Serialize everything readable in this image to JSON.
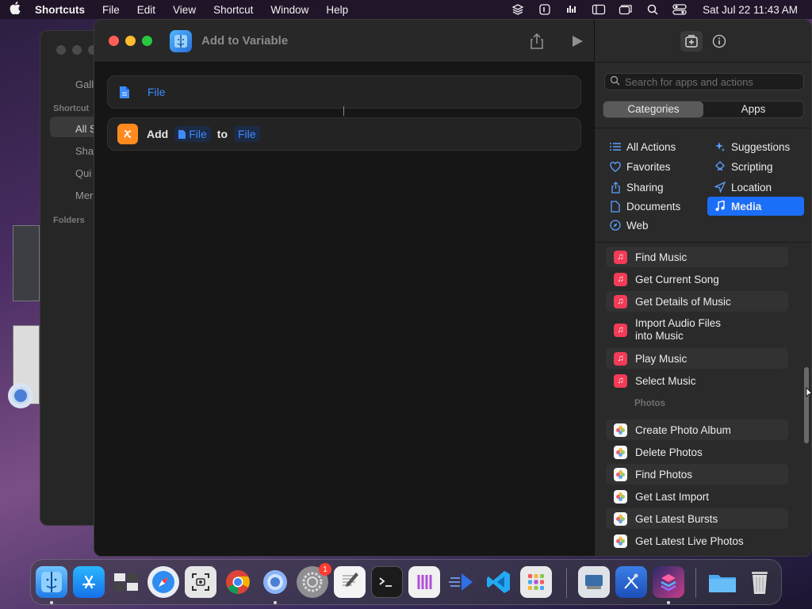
{
  "menubar": {
    "app_name": "Shortcuts",
    "items": [
      "File",
      "Edit",
      "View",
      "Shortcut",
      "Window",
      "Help"
    ],
    "clock": "Sat Jul 22  11:43 AM"
  },
  "background_window": {
    "items": [
      "Gall",
      "Shortcut",
      "All S",
      "Sha",
      "Qui",
      "Mer",
      "Folders"
    ]
  },
  "window": {
    "title": "Add to Variable"
  },
  "editor": {
    "action1": {
      "label": "File"
    },
    "action2": {
      "verb": "Add",
      "token1": "File",
      "connector": "to",
      "token2": "File"
    }
  },
  "panel": {
    "search_placeholder": "Search for apps and actions",
    "segments": [
      "Categories",
      "Apps"
    ],
    "categories_left": [
      {
        "label": "All Actions",
        "icon": "list-icon"
      },
      {
        "label": "Favorites",
        "icon": "heart-icon"
      },
      {
        "label": "Sharing",
        "icon": "share-icon"
      },
      {
        "label": "Documents",
        "icon": "document-icon"
      },
      {
        "label": "Web",
        "icon": "compass-icon"
      }
    ],
    "categories_right": [
      {
        "label": "Suggestions",
        "icon": "sparkle-icon"
      },
      {
        "label": "Scripting",
        "icon": "scripting-icon"
      },
      {
        "label": "Location",
        "icon": "location-icon"
      },
      {
        "label": "Media",
        "icon": "music-note-icon",
        "active": true
      }
    ],
    "music_actions": [
      "Find Music",
      "Get Current Song",
      "Get Details of Music",
      "Import Audio Files into Music",
      "Play Music",
      "Select Music"
    ],
    "photos_header": "Photos",
    "photo_actions": [
      "Create Photo Album",
      "Delete Photos",
      "Find Photos",
      "Get Last Import",
      "Get Latest Bursts",
      "Get Latest Live Photos"
    ]
  },
  "dock": {
    "apps": [
      "Finder",
      "App Store",
      "Preview",
      "Safari",
      "Screenshot",
      "Chrome",
      "Chromium",
      "System Settings",
      "TextEdit",
      "Terminal",
      "Instruments",
      "Xcode",
      "VS Code",
      "Launchpad",
      "Preview Scanner",
      "Xcode Tools",
      "Shortcuts",
      "Downloads",
      "Trash"
    ],
    "settings_badge": "1"
  },
  "colors": {
    "accent": "#1a6ef7",
    "token_blue": "#3d8bff",
    "music_red": "#f23b57",
    "variable_orange": "#ff8a1e"
  }
}
